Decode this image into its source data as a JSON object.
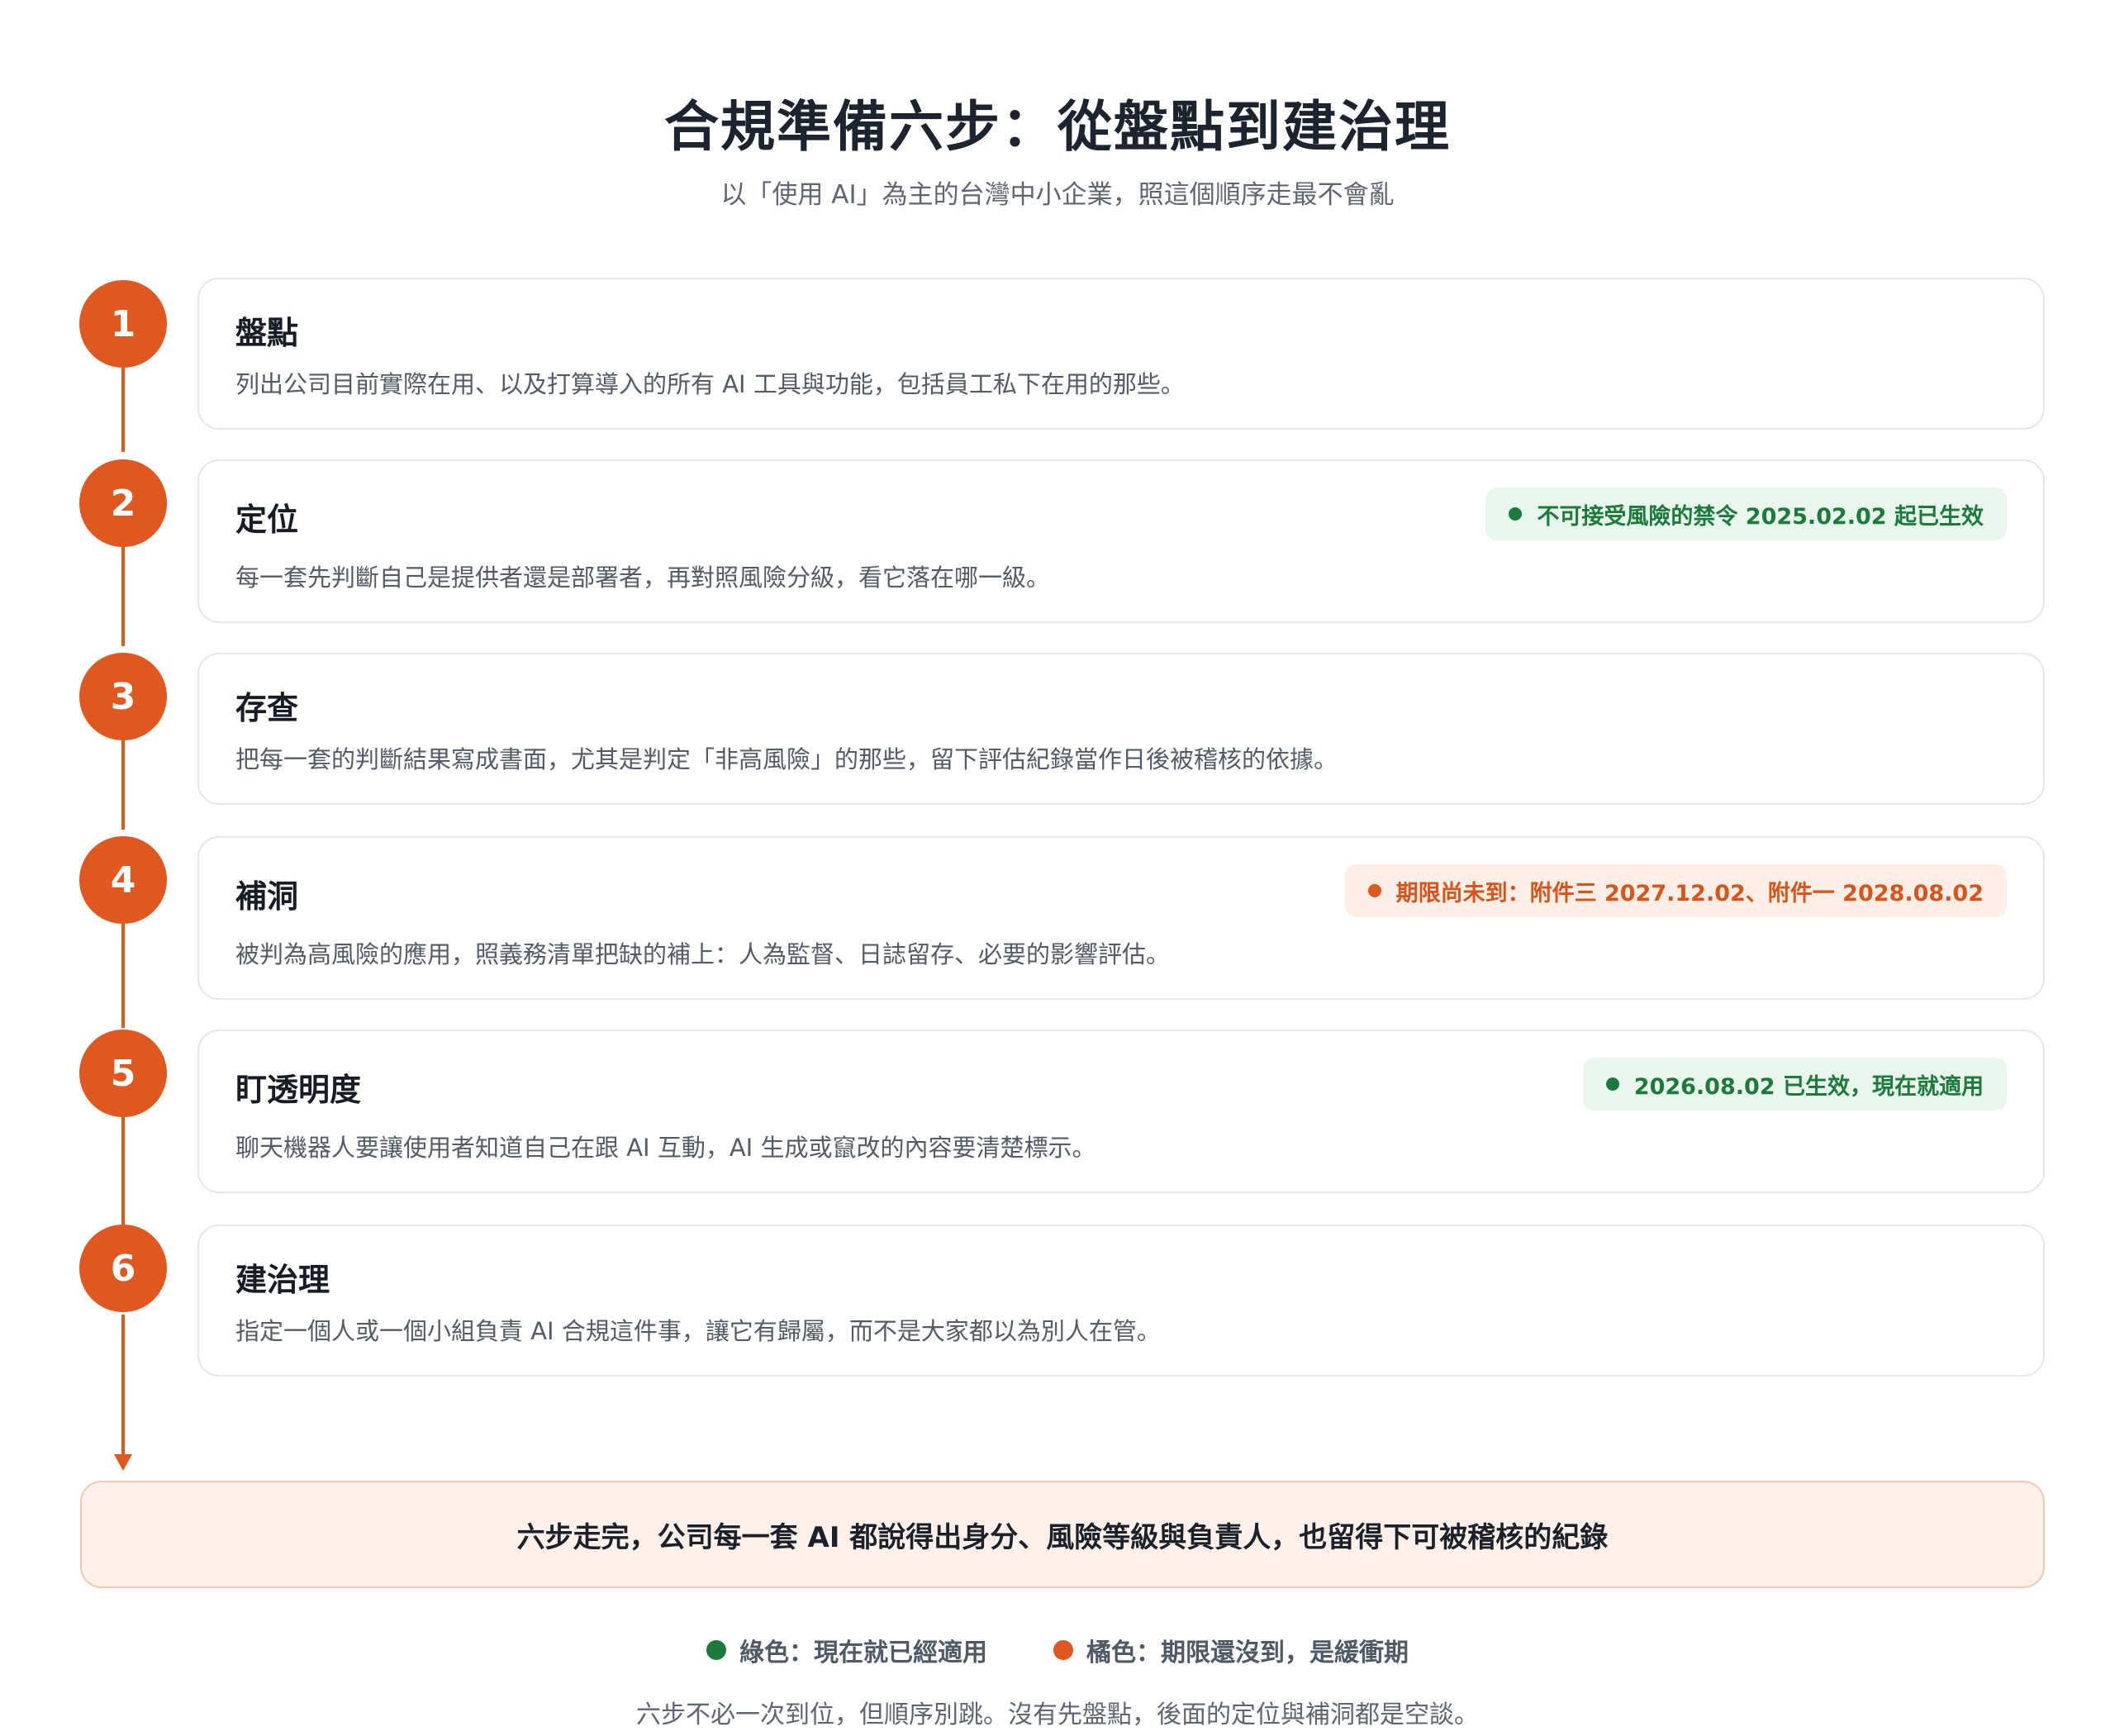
{
  "title": "合規準備六步：從盤點到建治理",
  "subtitle": "以「使用 AI」為主的台灣中小企業，照這個順序走最不會亂",
  "steps": [
    {
      "number": "1",
      "title": "盤點",
      "description": "列出公司目前實際在用、以及打算導入的所有 AI 工具與功能，包括員工私下在用的那些。",
      "badge": null
    },
    {
      "number": "2",
      "title": "定位",
      "description": "每一套先判斷自己是提供者還是部署者，再對照風險分級，看它落在哪一級。",
      "badge": {
        "text": "不可接受風險的禁令 2025.02.02 起已生效",
        "color": "green"
      }
    },
    {
      "number": "3",
      "title": "存查",
      "description": "把每一套的判斷結果寫成書面，尤其是判定「非高風險」的那些，留下評估紀錄當作日後被稽核的依據。",
      "badge": null
    },
    {
      "number": "4",
      "title": "補洞",
      "description": "被判為高風險的應用，照義務清單把缺的補上：人為監督、日誌留存、必要的影響評估。",
      "badge": {
        "text": "期限尚未到：附件三 2027.12.02、附件一 2028.08.02",
        "color": "orange"
      }
    },
    {
      "number": "5",
      "title": "盯透明度",
      "description": "聊天機器人要讓使用者知道自己在跟 AI 互動，AI 生成或竄改的內容要清楚標示。",
      "badge": {
        "text": "2026.08.02 已生效，現在就適用",
        "color": "green"
      }
    },
    {
      "number": "6",
      "title": "建治理",
      "description": "指定一個人或一個小組負責 AI 合規這件事，讓它有歸屬，而不是大家都以為別人在管。",
      "badge": null
    }
  ],
  "summary": "六步走完，公司每一套 AI 都說得出身分、風險等級與負責人，也留得下可被稽核的紀錄",
  "legend": {
    "green": "綠色：現在就已經適用",
    "orange": "橘色：期限還沒到，是緩衝期"
  },
  "footer": "六步不必一次到位，但順序別跳。沒有先盤點，後面的定位與補洞都是空談。",
  "colors": {
    "accent": "#e0571f",
    "green": "#1c7a3d",
    "green_bg": "#e8f6ec",
    "orange_bg": "#fdefe6",
    "summary_bg": "#fff1e9"
  }
}
